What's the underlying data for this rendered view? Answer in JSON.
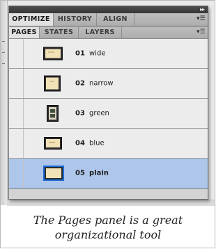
{
  "panel": {
    "tabs_row1": [
      "OPTIMIZE",
      "HISTORY",
      "ALIGN"
    ],
    "tabs_row2": [
      "PAGES",
      "STATES",
      "LAYERS"
    ],
    "active_row1": "OPTIMIZE",
    "active_row2": "PAGES",
    "collapse_glyph": "▸▸",
    "menu_glyph": "▾☰"
  },
  "pages": [
    {
      "number": "01",
      "name": "wide",
      "thumb": "wide",
      "selected": false
    },
    {
      "number": "02",
      "name": "narrow",
      "thumb": "narrow",
      "selected": false
    },
    {
      "number": "03",
      "name": "green",
      "thumb": "green",
      "selected": false
    },
    {
      "number": "04",
      "name": "blue",
      "thumb": "blue",
      "selected": false
    },
    {
      "number": "05",
      "name": "plain",
      "thumb": "plain",
      "selected": true
    }
  ],
  "caption": {
    "line1": "The Pages panel is a great",
    "line2": "organizational tool"
  },
  "colors": {
    "selected_row": "#adc6ea",
    "panel_header": "#3d3d3d",
    "selected_thumb_border": "#1c6bd6"
  }
}
